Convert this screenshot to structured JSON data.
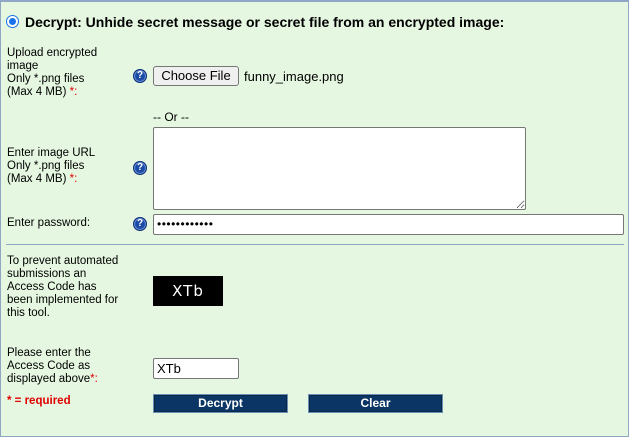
{
  "section": {
    "title": "Decrypt: Unhide secret message or secret file from an encrypted image:"
  },
  "upload": {
    "label_lines": [
      "Upload encrypted",
      "image",
      "Only *.png files",
      "(Max 4 MB) "
    ],
    "required_mark": "*:",
    "help_icon": "question-circle-icon",
    "button_label": "Choose File",
    "file_name": "funny_image.png"
  },
  "separator_text": "-- Or --",
  "url": {
    "label_lines": [
      "Enter image URL",
      "Only *.png files",
      "(Max 4 MB) "
    ],
    "required_mark": "*:",
    "value": ""
  },
  "password": {
    "label": "Enter password:",
    "masked_value": "••••••••••••"
  },
  "captcha": {
    "info_lines": [
      "To prevent automated",
      "submissions an",
      "Access Code has",
      "been implemented for",
      "this tool."
    ],
    "code_image_text": "XTb"
  },
  "access_code": {
    "label_lines": [
      "Please enter the",
      "Access Code as",
      "displayed above"
    ],
    "required_mark": "*:",
    "value": "XTb"
  },
  "required_note": "* = required",
  "buttons": {
    "decrypt": "Decrypt",
    "clear": "Clear"
  },
  "colors": {
    "panel_bg": "#e5f7e1",
    "button_bg": "#0b3564",
    "required": "#e00000",
    "help_icon": "#1b4ba5"
  }
}
